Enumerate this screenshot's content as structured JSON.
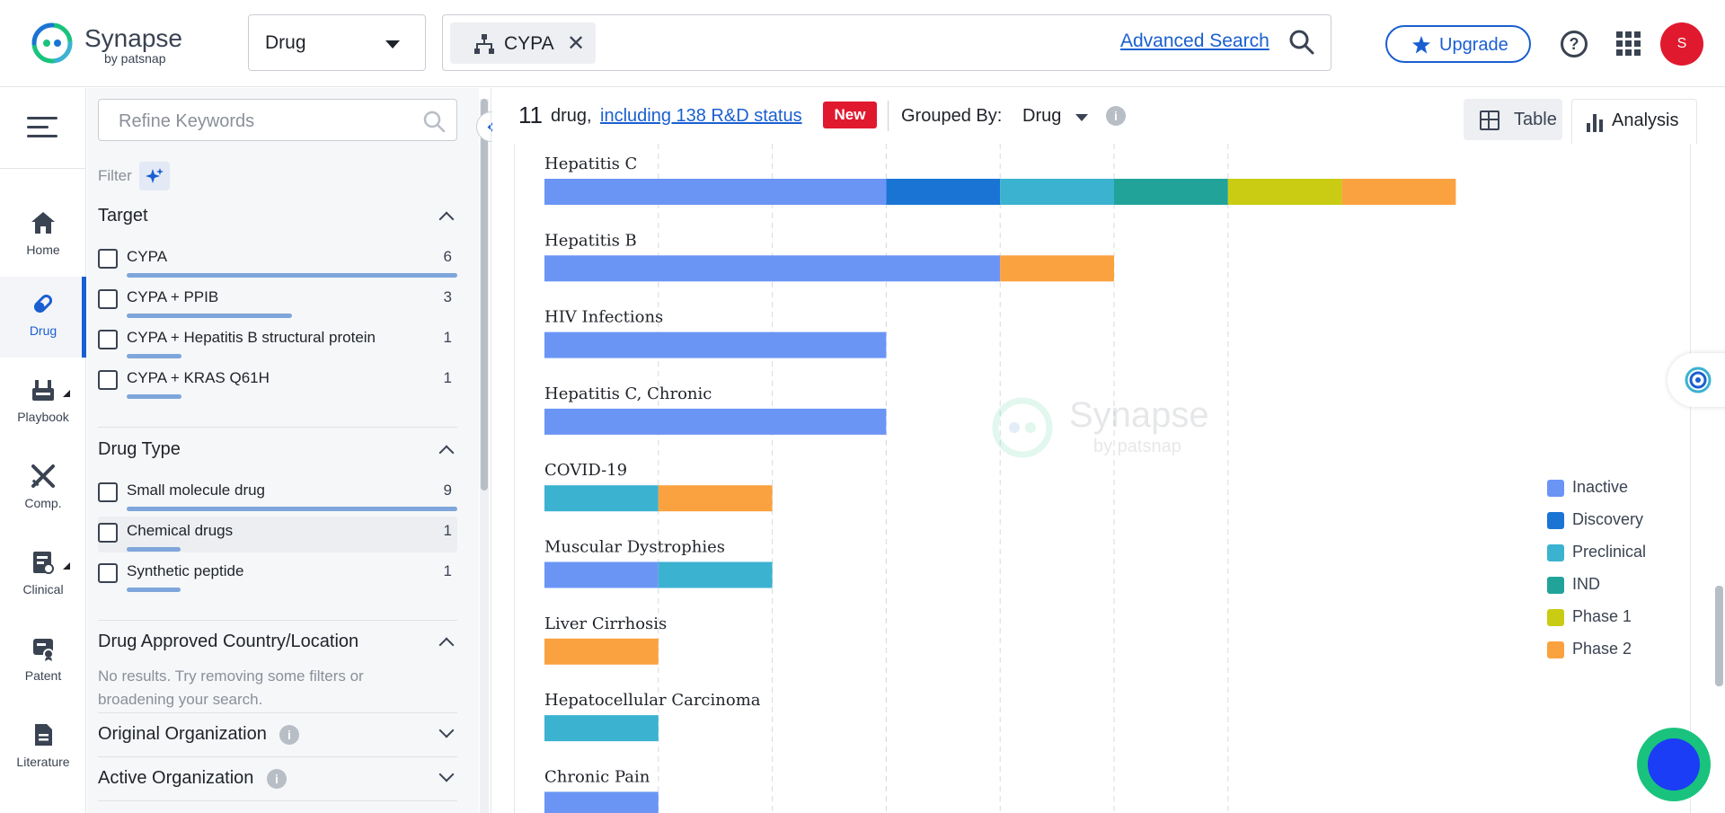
{
  "header": {
    "logo_text": "Synapse",
    "logo_sub": "by patsnap",
    "type_select": "Drug",
    "search_chip": "CYPA",
    "advanced_search": "Advanced Search",
    "upgrade": "Upgrade",
    "avatar_initial": "S"
  },
  "nav": {
    "items": [
      {
        "label": "Home",
        "icon": "home-icon"
      },
      {
        "label": "Drug",
        "icon": "pill-icon",
        "active": true
      },
      {
        "label": "Playbook",
        "icon": "playbook-icon"
      },
      {
        "label": "Comp.",
        "icon": "swords-icon"
      },
      {
        "label": "Clinical",
        "icon": "clinical-icon"
      },
      {
        "label": "Patent",
        "icon": "patent-icon"
      },
      {
        "label": "Literature",
        "icon": "literature-icon"
      }
    ]
  },
  "sidebar": {
    "refine_placeholder": "Refine Keywords",
    "filter_label": "Filter",
    "target": {
      "title": "Target",
      "items": [
        {
          "name": "CYPA",
          "count": "6",
          "fraction": 1.0
        },
        {
          "name": "CYPA + PPIB",
          "count": "3",
          "fraction": 0.5
        },
        {
          "name": "CYPA + Hepatitis B structural protein",
          "count": "1",
          "fraction": 0.167
        },
        {
          "name": "CYPA + KRAS Q61H",
          "count": "1",
          "fraction": 0.167
        }
      ]
    },
    "drug_type": {
      "title": "Drug Type",
      "items": [
        {
          "name": "Small molecule drug",
          "count": "9",
          "fraction": 1.0
        },
        {
          "name": "Chemical drugs",
          "count": "1",
          "fraction": 0.111
        },
        {
          "name": "Synthetic peptide",
          "count": "1",
          "fraction": 0.111
        }
      ]
    },
    "approved_country": {
      "title": "Drug Approved Country/Location",
      "no_results": "No results. Try removing some filters or broadening your search."
    },
    "original_org": {
      "title": "Original Organization"
    },
    "active_org": {
      "title": "Active Organization"
    }
  },
  "results": {
    "count": "11",
    "unit": "drug,",
    "link": "including 138 R&D status",
    "new_badge": "New",
    "grouped_by_label": "Grouped By:",
    "grouped_by_value": "Drug",
    "tab_table": "Table",
    "tab_analysis": "Analysis"
  },
  "chart_data": {
    "type": "bar",
    "orientation": "horizontal",
    "stacked": true,
    "categories": [
      "Hepatitis C",
      "Hepatitis B",
      "HIV Infections",
      "Hepatitis C, Chronic",
      "COVID-19",
      "Muscular Dystrophies",
      "Liver Cirrhosis",
      "Hepatocellular Carcinoma",
      "Chronic Pain"
    ],
    "series": [
      {
        "name": "Inactive",
        "color": "#6b95f5",
        "values": [
          3,
          4,
          3,
          3,
          0,
          1,
          0,
          0,
          1
        ]
      },
      {
        "name": "Discovery",
        "color": "#1a74d4",
        "values": [
          1,
          0,
          0,
          0,
          0,
          0,
          0,
          0,
          0
        ]
      },
      {
        "name": "Preclinical",
        "color": "#3bb2d0",
        "values": [
          1,
          0,
          0,
          0,
          1,
          1,
          0,
          1,
          0
        ]
      },
      {
        "name": "IND",
        "color": "#21a39a",
        "values": [
          1,
          0,
          0,
          0,
          0,
          0,
          0,
          0,
          0
        ]
      },
      {
        "name": "Phase 1",
        "color": "#c9cc12",
        "values": [
          1,
          0,
          0,
          0,
          0,
          0,
          0,
          0,
          0
        ]
      },
      {
        "name": "Phase 2",
        "color": "#fba240",
        "values": [
          1,
          1,
          0,
          0,
          1,
          0,
          1,
          0,
          0
        ]
      }
    ],
    "xlim": [
      0,
      8
    ],
    "grid": "vertical dashed",
    "legend_position": "right"
  },
  "watermark": {
    "text": "Synapse",
    "sub": "by patsnap"
  }
}
